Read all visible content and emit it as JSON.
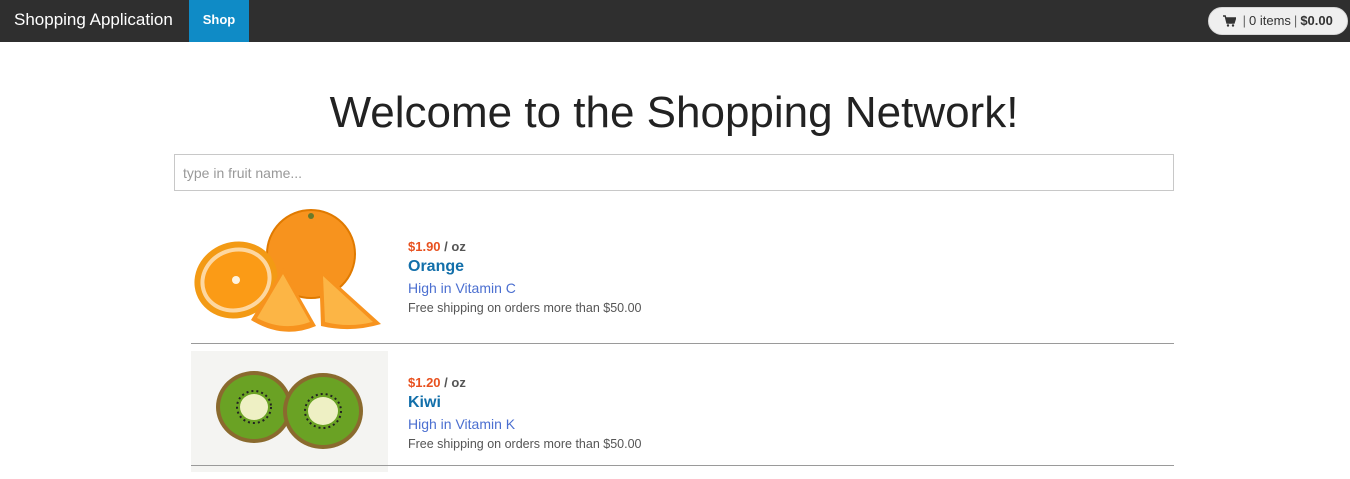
{
  "navbar": {
    "brand": "Shopping Application",
    "active_tab": "Shop",
    "cart": {
      "icon": "shopping-cart-icon",
      "separator": "|",
      "items": "0 items",
      "total": "$0.00"
    }
  },
  "hero": {
    "title": "Welcome to the Shopping Network!"
  },
  "search": {
    "placeholder": "type in fruit name...",
    "value": ""
  },
  "products": [
    {
      "price": "$1.90",
      "unit": " / oz",
      "name": "Orange",
      "description": "High in Vitamin C",
      "shipping": "Free shipping on orders more than $50.00",
      "image": "orange-image"
    },
    {
      "price": "$1.20",
      "unit": " / oz",
      "name": "Kiwi",
      "description": "High in Vitamin K",
      "shipping": "Free shipping on orders more than $50.00",
      "image": "kiwi-image"
    }
  ],
  "colors": {
    "navbar": "#2f2f2f",
    "active_tab": "#0f8bc6",
    "price": "#e8511f",
    "product_name": "#126faa",
    "description": "#4b6fd0"
  }
}
